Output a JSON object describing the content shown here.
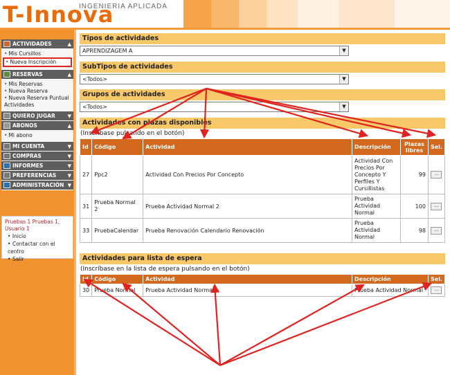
{
  "header": {
    "logo": "T-Innova",
    "tagline": "INGENIERIA APLICADA"
  },
  "sidebar": {
    "sections": [
      {
        "label": "ACTIVIDADES",
        "items": [
          "Mis Cursillos",
          "Nueva Inscripción"
        ],
        "selected_item": "Nueva Inscripción"
      },
      {
        "label": "RESERVAS",
        "items": [
          "Mis Reservas",
          "Nueva Reserva",
          "Nueva Reserva Puntual Actividades"
        ]
      },
      {
        "label": "QUIERO JUGAR",
        "items": []
      },
      {
        "label": "ABONOS",
        "items": [
          "Mi abono"
        ]
      },
      {
        "label": "MI CUENTA",
        "items": []
      },
      {
        "label": "COMPRAS",
        "items": []
      },
      {
        "label": "INFORMES",
        "items": []
      },
      {
        "label": "PREFERENCIAS",
        "items": []
      },
      {
        "label": "ADMINISTRACIÓN",
        "items": []
      }
    ],
    "user": {
      "name": "Pruebas 1 Pruebas 1, Usuario 1",
      "links": [
        "Inicio",
        "Contactar con el centro",
        "Salir"
      ]
    }
  },
  "filters": {
    "tipos": {
      "title": "Tipos de actividades",
      "value": "APRENDIZAGEM A"
    },
    "subtipos": {
      "title": "SubTipos de actividades",
      "value": "<Todos>"
    },
    "grupos": {
      "title": "Grupos de actividades",
      "value": "<Todos>"
    }
  },
  "disponibles": {
    "title": "Actividades con plazas disponibles",
    "hint": "(Inscríbase pulsando en el botón)",
    "columns": [
      "Id",
      "Código",
      "Actividad",
      "Descripción",
      "Plazas libres",
      "Sel."
    ],
    "rows": [
      {
        "id": "27",
        "codigo": "Ppc2",
        "actividad": "Actividad Con Precios Por Concepto",
        "descripcion": "Actividad Con Precios Por Concepto Y Perfiles Y Cursillistas",
        "plazas": "99",
        "btn": "..."
      },
      {
        "id": "31",
        "codigo": "Prueba Normal 2",
        "actividad": "Prueba Actividad Normal 2",
        "descripcion": "Prueba Actividad Normal",
        "plazas": "100",
        "btn": "..."
      },
      {
        "id": "33",
        "codigo": "PruebaCalendar",
        "actividad": "Prueba Renovación Calendario Renovación",
        "descripcion": "Prueba Actividad Normal",
        "plazas": "98",
        "btn": "..."
      }
    ]
  },
  "espera": {
    "title": "Actividades para lista de espera",
    "hint": "(Inscríbase en la lista de espera pulsando en el botón)",
    "columns": [
      "Id",
      "Código",
      "Actividad",
      "Descripción",
      "Sel."
    ],
    "rows": [
      {
        "id": "30",
        "codigo": "Prueba Normal",
        "actividad": "Prueba Actividad Normal",
        "descripcion": "Prueba Actividad Normal",
        "btn": "..."
      }
    ]
  },
  "colors": {
    "brand_orange": "#e66c0c",
    "table_header": "#d2691e",
    "section_title_bg": "#f9c869",
    "annotation_red": "#e0231f"
  }
}
